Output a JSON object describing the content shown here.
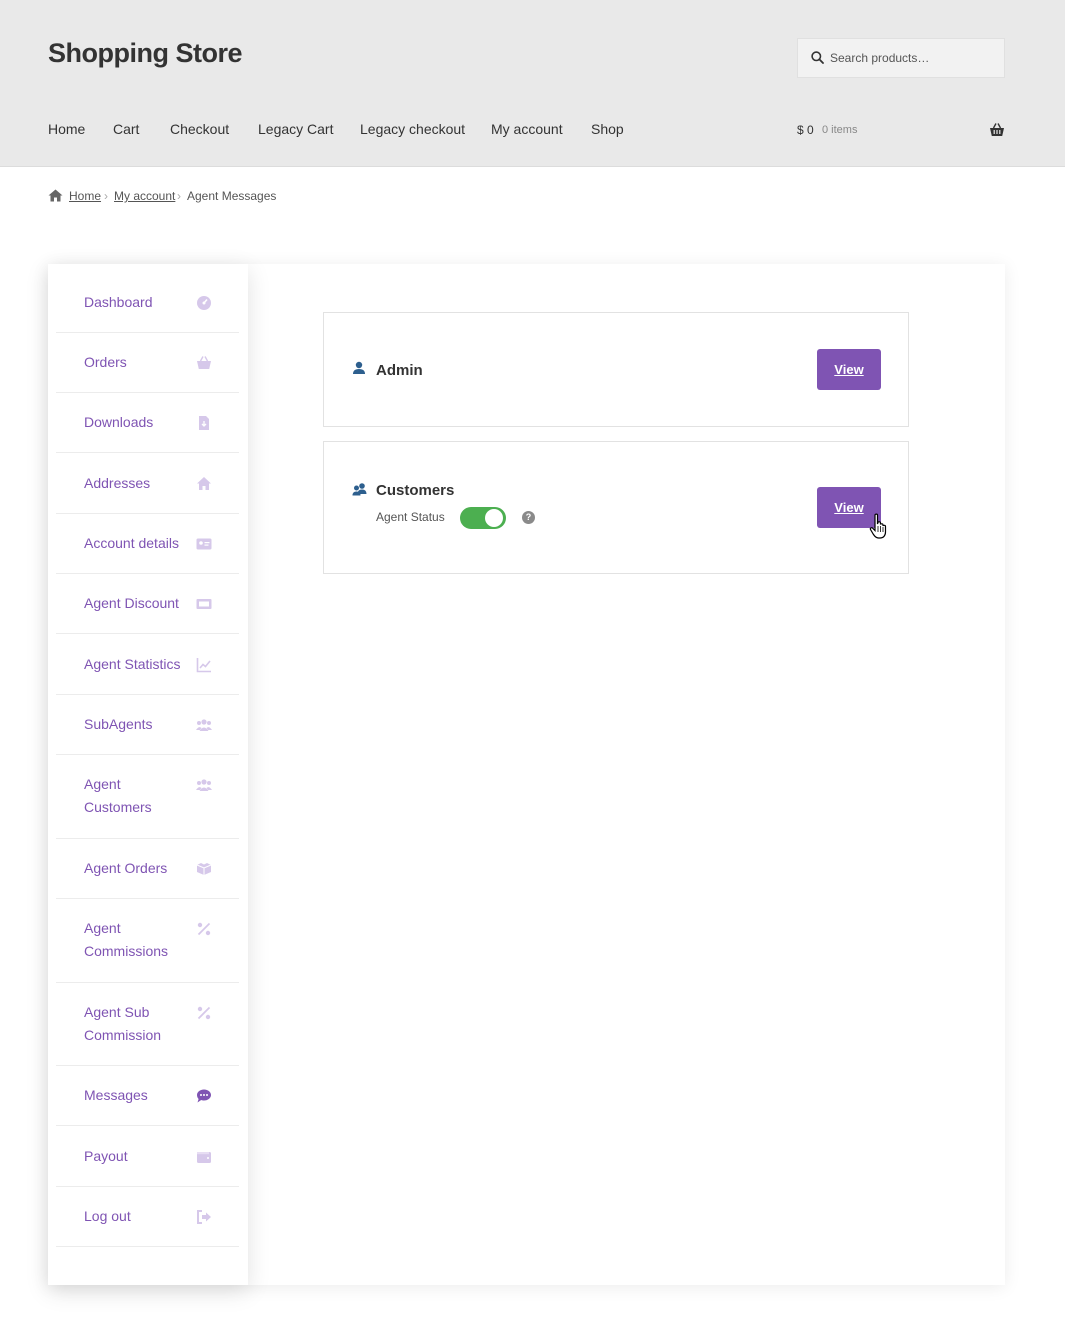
{
  "header": {
    "site_title": "Shopping Store",
    "search_placeholder": "Search products…",
    "nav": [
      "Home",
      "Cart",
      "Checkout",
      "Legacy Cart",
      "Legacy checkout",
      "My account",
      "Shop"
    ],
    "cart_amount": "$ 0",
    "cart_count": "0 items"
  },
  "breadcrumb": {
    "home": "Home",
    "my_account": "My account",
    "current": "Agent Messages"
  },
  "sidebar": {
    "items": [
      {
        "label": "Dashboard",
        "icon": "dashboard-gauge-icon"
      },
      {
        "label": "Orders",
        "icon": "basket-icon"
      },
      {
        "label": "Downloads",
        "icon": "file-download-icon"
      },
      {
        "label": "Addresses",
        "icon": "home-icon"
      },
      {
        "label": "Account details",
        "icon": "id-card-icon"
      },
      {
        "label": "Agent Discount",
        "icon": "ticket-icon"
      },
      {
        "label": "Agent Statistics",
        "icon": "line-chart-icon"
      },
      {
        "label": "SubAgents",
        "icon": "users-icon"
      },
      {
        "label": "Agent Customers",
        "icon": "users-icon"
      },
      {
        "label": "Agent Orders",
        "icon": "boxes-icon"
      },
      {
        "label": "Agent Commissions",
        "icon": "percent-icon"
      },
      {
        "label": "Agent Sub Commission",
        "icon": "percent-icon"
      },
      {
        "label": "Messages",
        "icon": "chat-bubble-icon",
        "active": true
      },
      {
        "label": "Payout",
        "icon": "wallet-icon"
      },
      {
        "label": "Log out",
        "icon": "sign-out-icon"
      }
    ]
  },
  "messages": {
    "admin": {
      "title": "Admin",
      "button": "View"
    },
    "customers": {
      "title": "Customers",
      "status_label": "Agent Status",
      "status_on": true,
      "button": "View"
    }
  },
  "colors": {
    "accent": "#7f54b3",
    "toggle_on": "#4caf50",
    "header_bg": "#e9e9e9"
  }
}
